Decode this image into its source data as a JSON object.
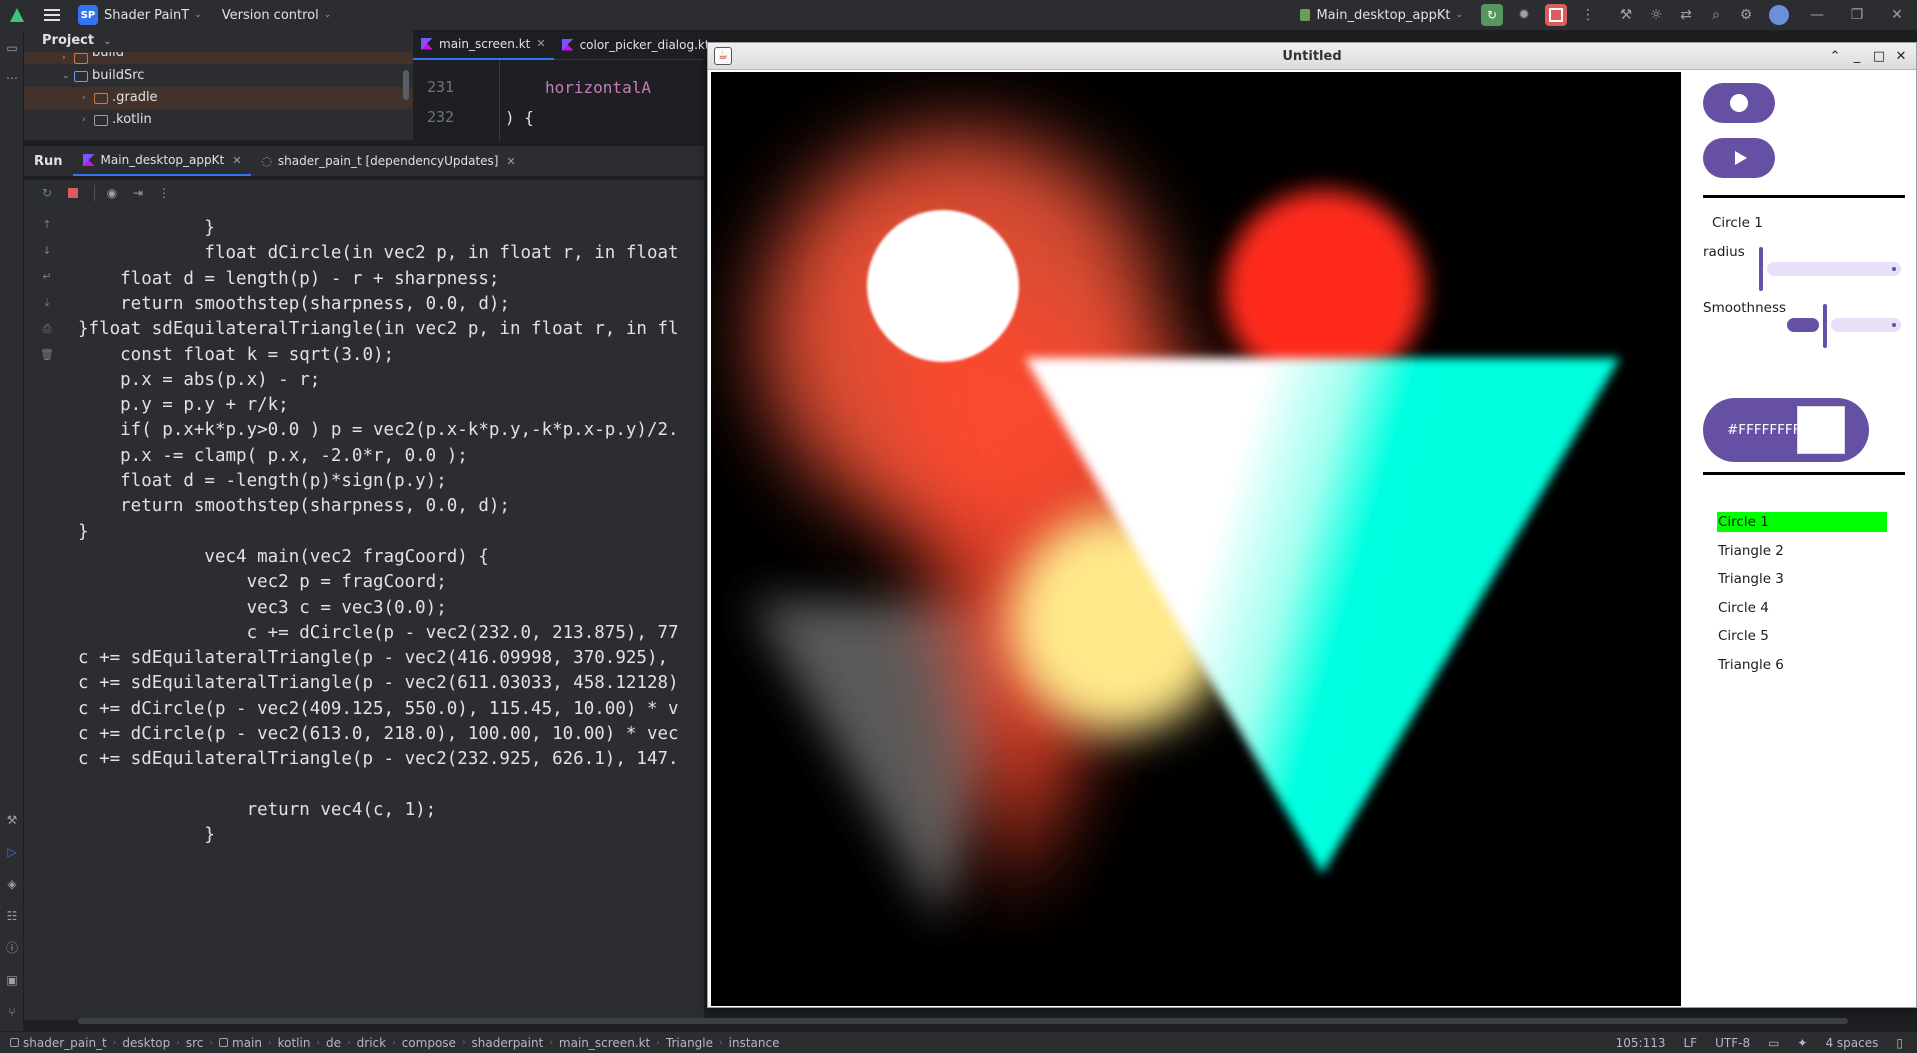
{
  "ide": {
    "project_name": "Shader PainT",
    "project_badge": "SP",
    "vcs_label": "Version control",
    "run_config": "Main_desktop_appKt"
  },
  "project_panel": {
    "title": "Project",
    "tree": [
      {
        "label": "build"
      },
      {
        "label": "buildSrc"
      },
      {
        "label": ".gradle"
      },
      {
        "label": ".kotlin"
      }
    ]
  },
  "editor": {
    "tabs": [
      {
        "label": "main_screen.kt"
      },
      {
        "label": "color_picker_dialog.kt"
      }
    ],
    "line_numbers": [
      "231",
      "232"
    ],
    "code_lines": [
      "horizontalA",
      ") {"
    ]
  },
  "run_panel": {
    "title": "Run",
    "tabs": [
      {
        "label": "Main_desktop_appKt"
      },
      {
        "label": "shader_pain_t [dependencyUpdates]"
      }
    ]
  },
  "console_lines": [
    "            }",
    "            float dCircle(in vec2 p, in float r, in float",
    "    float d = length(p) - r + sharpness;",
    "    return smoothstep(sharpness, 0.0, d);",
    "}float sdEquilateralTriangle(in vec2 p, in float r, in fl",
    "    const float k = sqrt(3.0);",
    "    p.x = abs(p.x) - r;",
    "    p.y = p.y + r/k;",
    "    if( p.x+k*p.y>0.0 ) p = vec2(p.x-k*p.y,-k*p.x-p.y)/2.",
    "    p.x -= clamp( p.x, -2.0*r, 0.0 );",
    "    float d = -length(p)*sign(p.y);",
    "    return smoothstep(sharpness, 0.0, d);",
    "}",
    "            vec4 main(vec2 fragCoord) {",
    "                vec2 p = fragCoord;",
    "                vec3 c = vec3(0.0);",
    "                c += dCircle(p - vec2(232.0, 213.875), 77",
    "c += sdEquilateralTriangle(p - vec2(416.09998, 370.925),",
    "c += sdEquilateralTriangle(p - vec2(611.03033, 458.12128)",
    "c += dCircle(p - vec2(409.125, 550.0), 115.45, 10.00) * v",
    "c += dCircle(p - vec2(613.0, 218.0), 100.00, 10.00) * vec",
    "c += sdEquilateralTriangle(p - vec2(232.925, 626.1), 147.",
    "",
    "                return vec4(c, 1);",
    "            }"
  ],
  "status_bar": {
    "breadcrumbs": [
      "shader_pain_t",
      "desktop",
      "src",
      "main",
      "kotlin",
      "de",
      "drick",
      "compose",
      "shaderpaint",
      "main_screen.kt",
      "Triangle",
      "instance"
    ],
    "position": "105:113",
    "line_ending": "LF",
    "encoding": "UTF-8",
    "indent": "4 spaces"
  },
  "app_window": {
    "title": "Untitled",
    "selected_shape_title": "Circle 1",
    "radius_label": "radius",
    "radius_value": 0.0,
    "smoothness_label": "Smoothness",
    "smoothness_value": 0.25,
    "color_hex": "#FFFFFFFF",
    "shapes": [
      {
        "label": "Circle 1",
        "selected": true
      },
      {
        "label": "Triangle 2",
        "selected": false
      },
      {
        "label": "Triangle 3",
        "selected": false
      },
      {
        "label": "Circle 4",
        "selected": false
      },
      {
        "label": "Circle 5",
        "selected": false
      },
      {
        "label": "Triangle 6",
        "selected": false
      }
    ],
    "accent_color": "#6650a4",
    "selection_color": "#00ff00"
  }
}
